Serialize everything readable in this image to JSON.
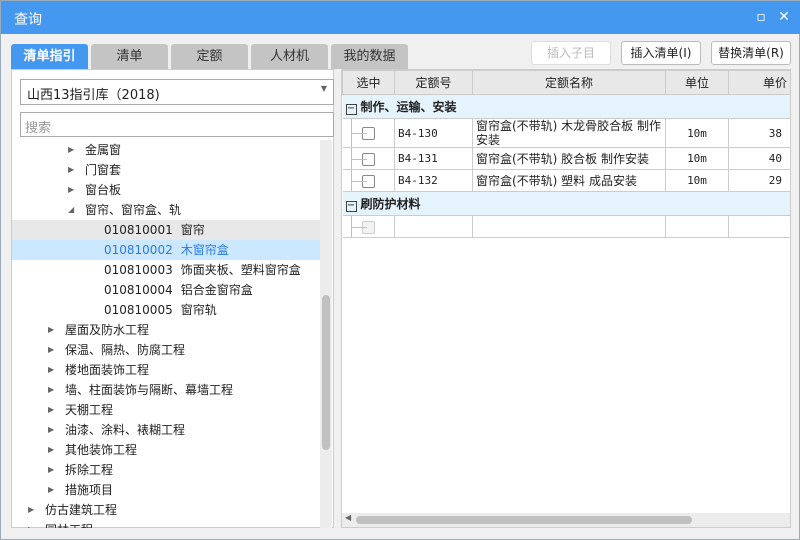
{
  "window": {
    "title": "查询"
  },
  "tabs": [
    "清单指引",
    "清单",
    "定额",
    "人材机",
    "我的数据"
  ],
  "buttons": {
    "insert_sub": "插入子目",
    "insert_list": "插入清单(I)",
    "replace_list": "替换清单(R)"
  },
  "library": {
    "selected": "山西13指引库（2018)"
  },
  "search": {
    "placeholder": "搜索"
  },
  "tree": [
    {
      "label": "金属窗",
      "level": 2,
      "expander": "collapsed"
    },
    {
      "label": "门窗套",
      "level": 2,
      "expander": "collapsed"
    },
    {
      "label": "窗台板",
      "level": 2,
      "expander": "collapsed"
    },
    {
      "label": "窗帘、窗帘盒、轨",
      "level": 2,
      "expander": "expanded"
    },
    {
      "code": "010810001",
      "label": "窗帘",
      "level": 3,
      "state": "hover"
    },
    {
      "code": "010810002",
      "label": "木窗帘盒",
      "level": 3,
      "state": "selected"
    },
    {
      "code": "010810003",
      "label": "饰面夹板、塑料窗帘盒",
      "level": 3
    },
    {
      "code": "010810004",
      "label": "铝合金窗帘盒",
      "level": 3
    },
    {
      "code": "010810005",
      "label": "窗帘轨",
      "level": 3
    },
    {
      "label": "屋面及防水工程",
      "level": 1,
      "expander": "collapsed"
    },
    {
      "label": "保温、隔热、防腐工程",
      "level": 1,
      "expander": "collapsed"
    },
    {
      "label": "楼地面装饰工程",
      "level": 1,
      "expander": "collapsed"
    },
    {
      "label": "墙、柱面装饰与隔断、幕墙工程",
      "level": 1,
      "expander": "collapsed"
    },
    {
      "label": "天棚工程",
      "level": 1,
      "expander": "collapsed"
    },
    {
      "label": "油漆、涂料、裱糊工程",
      "level": 1,
      "expander": "collapsed"
    },
    {
      "label": "其他装饰工程",
      "level": 1,
      "expander": "collapsed"
    },
    {
      "label": "拆除工程",
      "level": 1,
      "expander": "collapsed"
    },
    {
      "label": "措施项目",
      "level": 1,
      "expander": "collapsed"
    },
    {
      "label": "仿古建筑工程",
      "level": 0,
      "expander": "collapsed"
    },
    {
      "label": "园林工程",
      "level": 0,
      "expander": "collapsed"
    }
  ],
  "grid": {
    "columns": [
      "选中",
      "定额号",
      "定额名称",
      "单位",
      "单价"
    ],
    "groups": [
      {
        "title": "制作、运输、安装",
        "rows": [
          {
            "code": "B4-130",
            "name": "窗帘盒(不带轨) 木龙骨胶合板 制作安装",
            "unit": "10m",
            "price": "38"
          },
          {
            "code": "B4-131",
            "name": "窗帘盒(不带轨) 胶合板 制作安装",
            "unit": "10m",
            "price": "40"
          },
          {
            "code": "B4-132",
            "name": "窗帘盒(不带轨) 塑料 成品安装",
            "unit": "10m",
            "price": "29"
          }
        ]
      },
      {
        "title": "刷防护材料",
        "rows": [
          {
            "code": "",
            "name": "",
            "unit": "",
            "price": ""
          }
        ]
      }
    ]
  },
  "colors": {
    "accent": "#4598f0",
    "selected_bg": "#cce8ff",
    "group_bg": "#e5f3fd"
  }
}
